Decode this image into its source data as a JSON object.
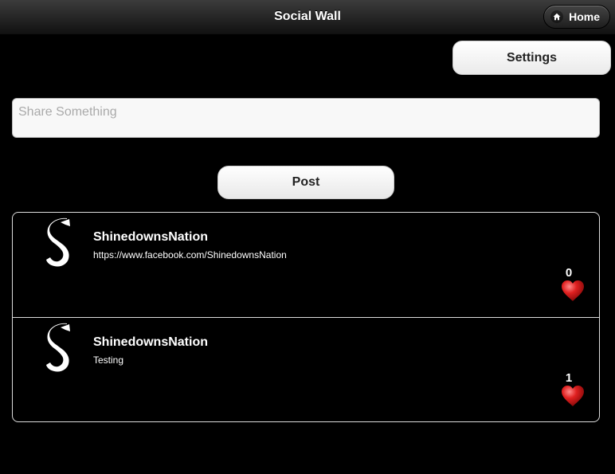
{
  "header": {
    "title": "Social Wall",
    "home_label": "Home"
  },
  "toolbar": {
    "settings_label": "Settings"
  },
  "composer": {
    "placeholder": "Share Something",
    "post_label": "Post"
  },
  "posts": [
    {
      "user": "ShinedownsNation",
      "text": "https://www.facebook.com/ShinedownsNation",
      "likes": "0",
      "avatar_icon": "shinedown-s-logo-icon",
      "like_icon": "heart-icon"
    },
    {
      "user": "ShinedownsNation",
      "text": "Testing",
      "likes": "1",
      "avatar_icon": "shinedown-s-logo-icon",
      "like_icon": "heart-icon"
    }
  ],
  "colors": {
    "background": "#000000",
    "heart": "#e02020",
    "button_bg": "#f4f4f4"
  }
}
